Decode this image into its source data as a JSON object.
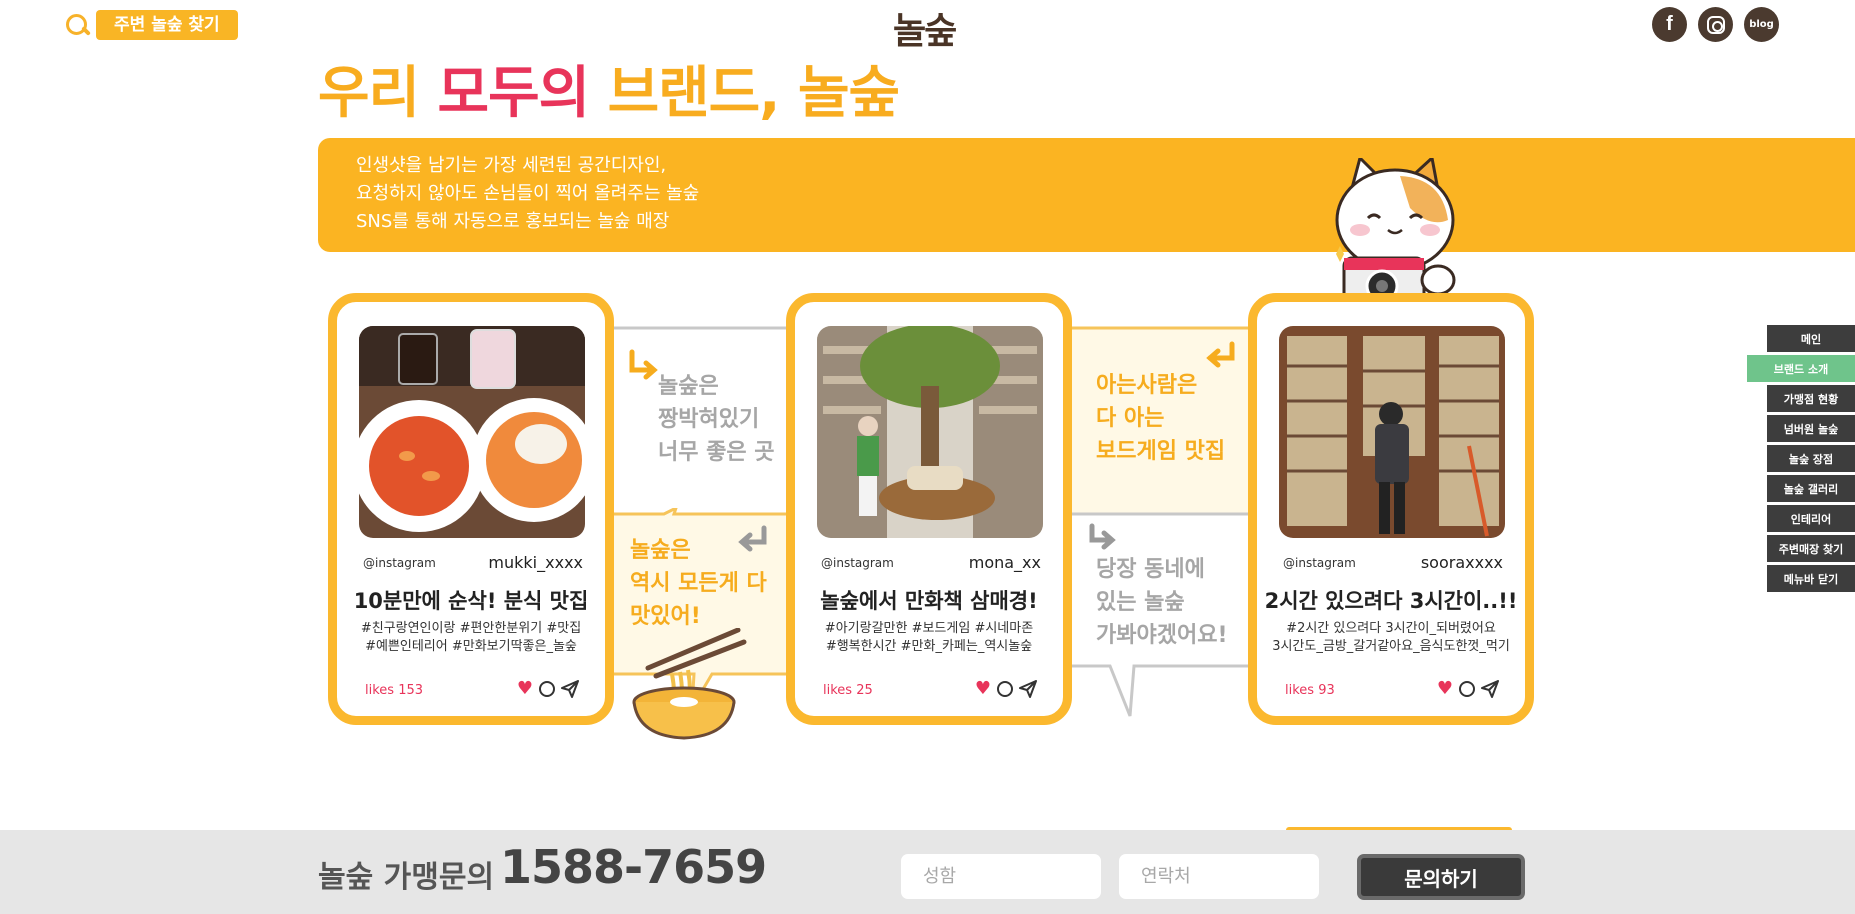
{
  "header": {
    "nearby_button": "주변 놀숲 찾기",
    "logo": "놀숲",
    "social": {
      "facebook": "f",
      "blog": "blog"
    }
  },
  "hero": {
    "headline_part1": "우리",
    "headline_part2": "모두의",
    "headline_part3": "브랜드, 놀숲",
    "banner_lines": [
      "인생샷을 남기는 가장 세련된 공간디자인,",
      "요청하지 않아도 손님들이 찍어 올려주는 놀숲",
      "SNS를 통해 자동으로 홍보되는 놀숲 매장"
    ]
  },
  "bubbles": {
    "b1": [
      "놀숲은",
      "짱박혀있기",
      "너무 좋은 곳"
    ],
    "b2": [
      "놀숲은",
      "역시 모든게 다",
      "맛있어!"
    ],
    "b3": [
      "아는사람은",
      "다 아는",
      "보드게임 맛집"
    ],
    "b4": [
      "당장 동네에",
      "있는 놀숲",
      "가봐야겠어요!"
    ]
  },
  "cards": [
    {
      "ig_label": "@instagram",
      "username": "mukki_xxxx",
      "title": "10분만에 순삭! 분식 맛집",
      "tags_line1": "#친구랑연인이랑 #편안한분위기 #맛집",
      "tags_line2": "#예쁜인테리어 #만화보기딱좋은_놀숲",
      "likes": "likes 153"
    },
    {
      "ig_label": "@instagram",
      "username": "mona_xx",
      "title": "놀숲에서 만화책 삼매경!",
      "tags_line1": "#아기랑갈만한 #보드게임 #시네마존",
      "tags_line2": "#행복한시간 #만화_카페는_역시놀숲",
      "likes": "likes 25"
    },
    {
      "ig_label": "@instagram",
      "username": "sooraxxxx",
      "title": "2시간 있으려다 3시간이..!!",
      "tags_line1": "#2시간 있으려다 3시간이_되버렸어요",
      "tags_line2": "3시간도_금방_갈거같아요_음식도한껏_먹기",
      "likes": "likes 93"
    }
  ],
  "sidenav": [
    "메인",
    "브랜드 소개",
    "가맹점 현황",
    "넘버원 놀숲",
    "놀숲 장점",
    "놀숲 갤러리",
    "인테리어",
    "주변매장 찾기",
    "메뉴바 닫기"
  ],
  "bottom": {
    "label": "놀숲 가맹문의",
    "phone": "1588-7659",
    "name_placeholder": "성함",
    "contact_placeholder": "연락처",
    "submit": "문의하기"
  }
}
